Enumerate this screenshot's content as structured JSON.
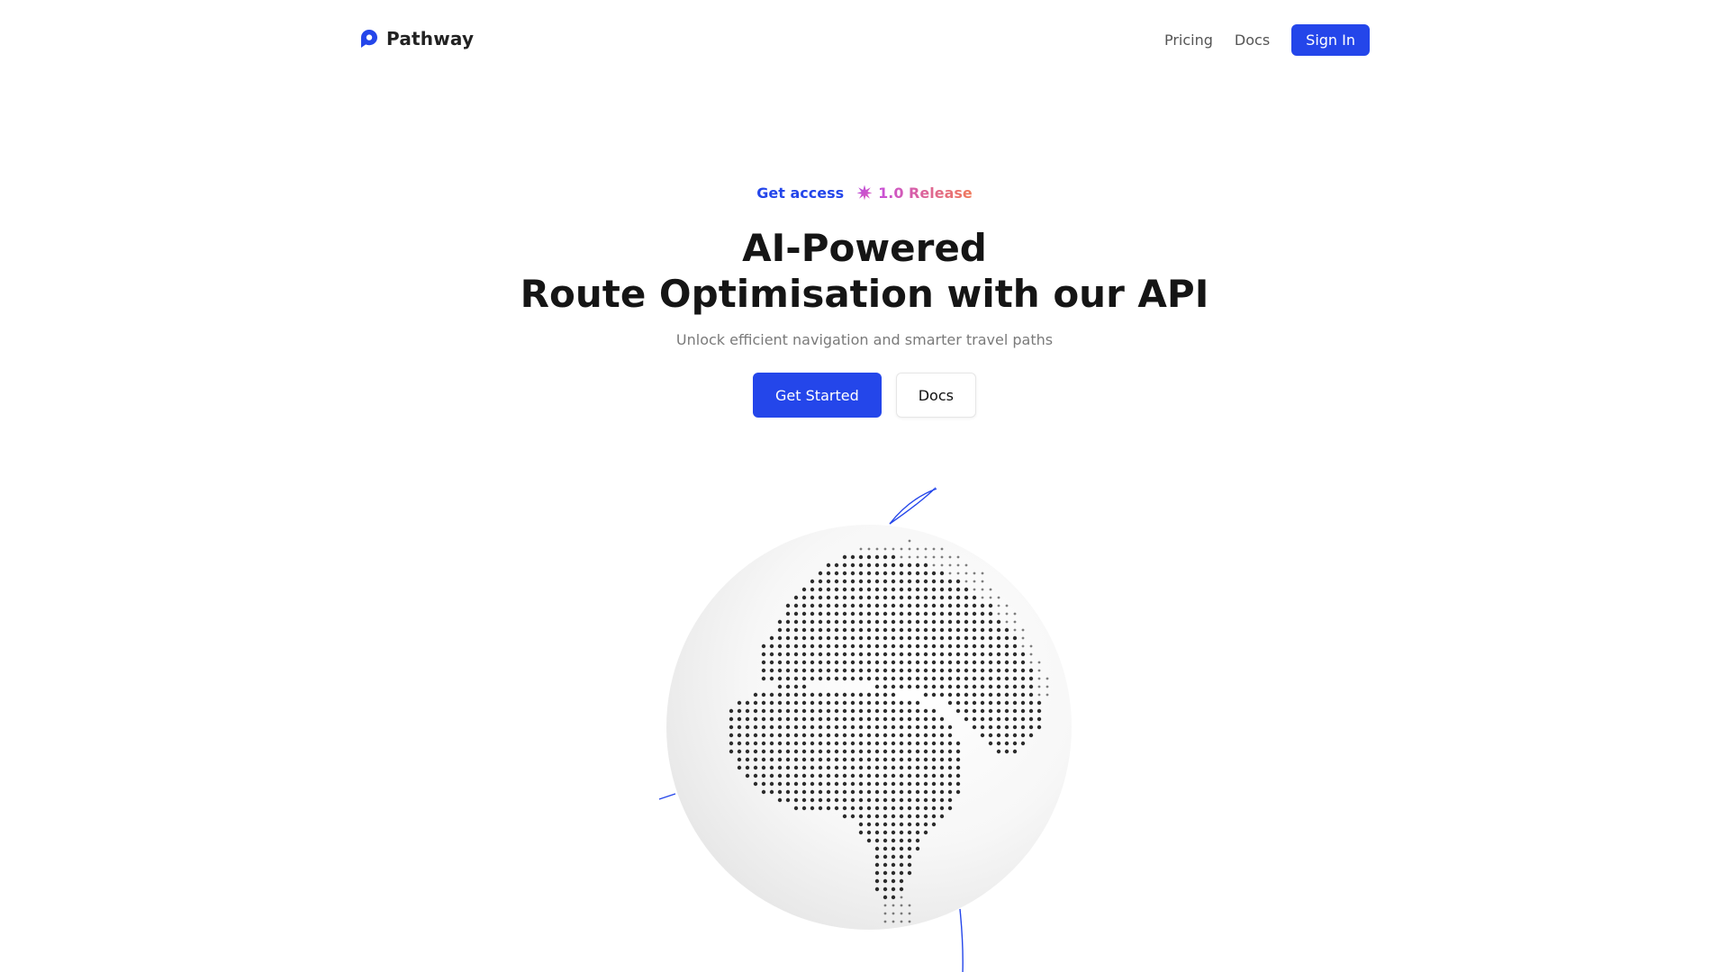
{
  "brand": {
    "name": "Pathway",
    "icon": "location-pin-icon",
    "color": "#2446ea"
  },
  "nav": {
    "links": [
      "Pricing",
      "Docs"
    ],
    "signin_label": "Sign In"
  },
  "hero": {
    "get_access_label": "Get access",
    "release_icon": "sparkle-icon",
    "release_label": "1.0 Release",
    "headline_line1": "AI-Powered",
    "headline_line2": "Route Optimisation with our API",
    "subtitle": "Unlock efficient navigation and smarter travel paths",
    "primary_cta": "Get Started",
    "secondary_cta": "Docs"
  },
  "globe": {
    "illustration": "dotted-world-globe",
    "accent_color": "#2446ea"
  }
}
